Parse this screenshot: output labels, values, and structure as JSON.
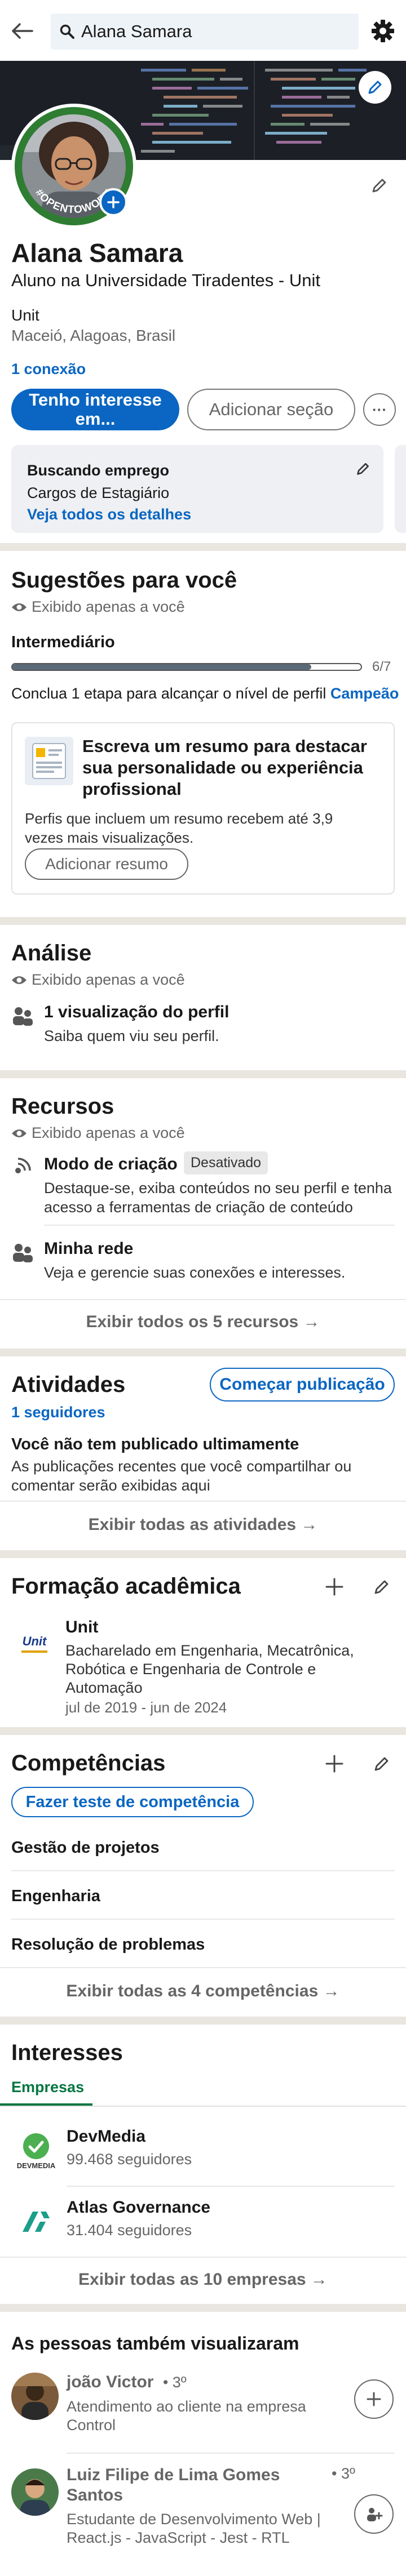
{
  "search": {
    "value": "Alana Samara"
  },
  "profile": {
    "badge_text": "#OPENTOWORK",
    "name": "Alana Samara",
    "headline": "Aluno na Universidade Tiradentes - Unit",
    "company": "Unit",
    "location": "Maceió, Alagoas, Brasil",
    "connections": "1 conexão",
    "btn_interest": "Tenho interesse em...",
    "btn_add_section": "Adicionar seção",
    "more": "···"
  },
  "job_card": {
    "title": "Buscando emprego",
    "subtitle": "Cargos de Estagiário",
    "link": "Veja todos os detalhes"
  },
  "suggestions": {
    "title": "Sugestões para você",
    "private": "Exibido apenas a você",
    "level": "Intermediário",
    "progress_text": "6/7",
    "progress": 0.857,
    "cta_prefix": "Conclua 1 etapa para alcançar o nível de perfil ",
    "cta_level": "Campeão",
    "card_title": "Escreva um resumo para destacar sua personalidade ou experiência profissional",
    "card_text": "Perfis que incluem um resumo recebem até 3,9 vezes mais visualizações.",
    "card_button": "Adicionar resumo"
  },
  "analysis": {
    "title": "Análise",
    "private": "Exibido apenas a você",
    "item_title": "1 visualização do perfil",
    "item_text": "Saiba quem viu seu perfil."
  },
  "resources": {
    "title": "Recursos",
    "private": "Exibido apenas a você",
    "item1_title": "Modo de criação",
    "item1_badge": "Desativado",
    "item1_text": "Destaque-se, exiba conteúdos no seu perfil e tenha acesso a ferramentas de criação de conteúdo",
    "item2_title": "Minha rede",
    "item2_text": "Veja e gerencie suas conexões e interesses.",
    "footer": "Exibir todos os 5 recursos →"
  },
  "activity": {
    "title": "Atividades",
    "followers": "1 seguidores",
    "start_button": "Começar publicação",
    "empty_title": "Você não tem publicado ultimamente",
    "empty_text": "As publicações recentes que você compartilhar ou comentar serão exibidas aqui",
    "footer": "Exibir todas as atividades →"
  },
  "education": {
    "title": "Formação acadêmica",
    "school": "Unit",
    "logo_text": "Unit",
    "degree": "Bacharelado em Engenharia, Mecatrônica, Robótica e Engenharia de Controle e Automação",
    "dates": "jul de 2019 - jun de 2024"
  },
  "skills": {
    "title": "Competências",
    "test_button": "Fazer teste de competência",
    "items": [
      "Gestão de projetos",
      "Engenharia",
      "Resolução de problemas"
    ],
    "footer": "Exibir todas as 4 competências →"
  },
  "interests": {
    "title": "Interesses",
    "tab": "Empresas",
    "companies": [
      {
        "name": "DevMedia",
        "followers": "99.468 seguidores",
        "logo_text": "DEVMEDIA"
      },
      {
        "name": "Atlas Governance",
        "followers": "31.404 seguidores"
      }
    ],
    "footer": "Exibir todas as 10 empresas →"
  },
  "people": {
    "title": "As pessoas também visualizaram",
    "items": [
      {
        "name": "joão Victor",
        "degree": "• 3º",
        "headline": "Atendimento ao cliente na empresa Control"
      },
      {
        "name": "Luiz Filipe de Lima Gomes Santos",
        "degree": "• 3º",
        "headline": "Estudante de Desenvolvimento Web | React.js - JavaScript - Jest - RTL"
      }
    ]
  },
  "colors": {
    "brand": "#0a66c2",
    "open_to_work": "#2e7d32",
    "gray_bg": "#e9e5df"
  }
}
